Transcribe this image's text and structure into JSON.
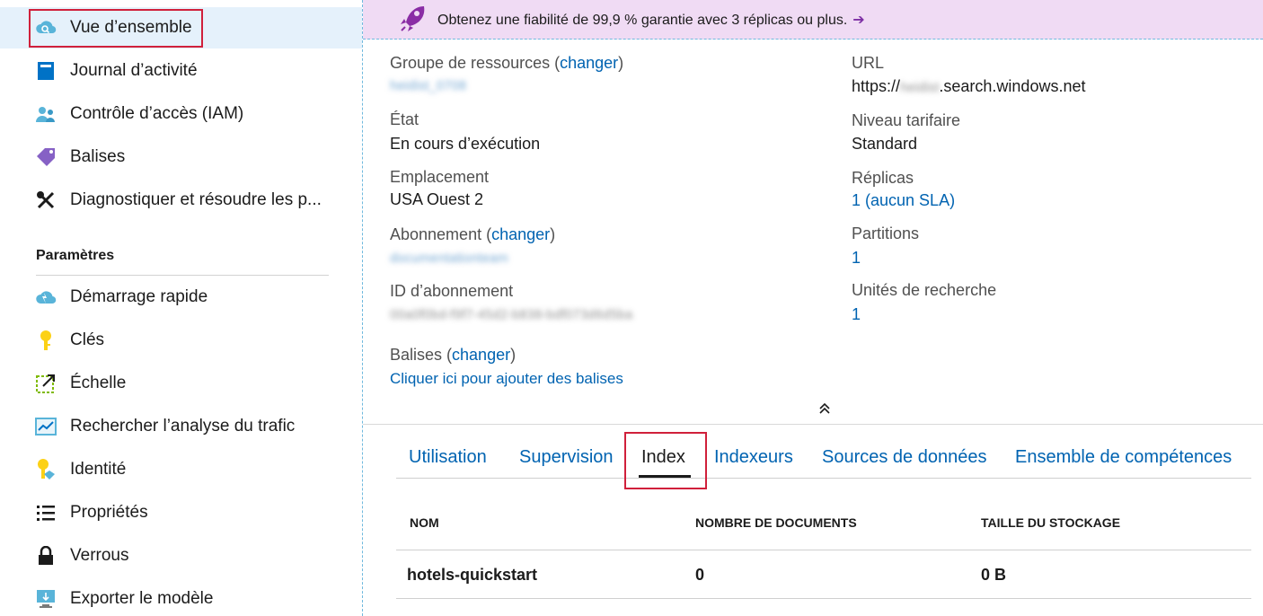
{
  "banner": {
    "text": "Obtenez une fiabilité de 99,9 % garantie avec 3 réplicas ou plus.",
    "arrow": "➔"
  },
  "sidebar": {
    "items_top": [
      {
        "label": "Vue d’ensemble",
        "icon": "cloud-search-icon"
      },
      {
        "label": "Journal d’activité",
        "icon": "activity-log-icon"
      },
      {
        "label": "Contrôle d’accès (IAM)",
        "icon": "access-control-icon"
      },
      {
        "label": "Balises",
        "icon": "tag-icon"
      },
      {
        "label": "Diagnostiquer et résoudre les p...",
        "icon": "wrench-screwdriver-icon"
      }
    ],
    "section_title": "Paramètres",
    "items_settings": [
      {
        "label": "Démarrage rapide",
        "icon": "quickstart-cloud-icon"
      },
      {
        "label": "Clés",
        "icon": "key-icon"
      },
      {
        "label": "Échelle",
        "icon": "scale-icon"
      },
      {
        "label": "Rechercher l’analyse du trafic",
        "icon": "traffic-analytics-icon"
      },
      {
        "label": "Identité",
        "icon": "identity-key-icon"
      },
      {
        "label": "Propriétés",
        "icon": "properties-list-icon"
      },
      {
        "label": "Verrous",
        "icon": "lock-icon"
      },
      {
        "label": "Exporter le modèle",
        "icon": "export-template-icon"
      }
    ]
  },
  "essentials": {
    "left": {
      "resource_group_label": "Groupe de ressources",
      "change_link": "changer",
      "resource_group_value": "heidist_0708",
      "state_label": "État",
      "state_value": "En cours d’exécution",
      "location_label": "Emplacement",
      "location_value": "USA Ouest 2",
      "subscription_label": "Abonnement",
      "subscription_value": "documentationteam",
      "subscription_id_label": "ID d’abonnement",
      "subscription_id_value": "00a0f0bd-f9f7-45d2-b838-bdf073d6d5ba",
      "tags_label": "Balises",
      "tags_link": "Cliquer ici pour ajouter des balises"
    },
    "right": {
      "url_label": "URL",
      "url_prefix": "https://",
      "url_hidden": "heidist",
      "url_suffix": ".search.windows.net",
      "tier_label": "Niveau tarifaire",
      "tier_value": "Standard",
      "replicas_label": "Réplicas",
      "replicas_value": "1 (aucun SLA)",
      "partitions_label": "Partitions",
      "partitions_value": "1",
      "search_units_label": "Unités de recherche",
      "search_units_value": "1"
    }
  },
  "tabs": [
    {
      "label": "Utilisation"
    },
    {
      "label": "Supervision"
    },
    {
      "label": "Index"
    },
    {
      "label": "Indexeurs"
    },
    {
      "label": "Sources de données"
    },
    {
      "label": "Ensemble de compétences"
    }
  ],
  "table": {
    "headers": [
      "NOM",
      "NOMBRE DE DOCUMENTS",
      "TAILLE DU STOCKAGE"
    ],
    "rows": [
      [
        "hotels-quickstart",
        "0",
        "0 B"
      ]
    ]
  }
}
